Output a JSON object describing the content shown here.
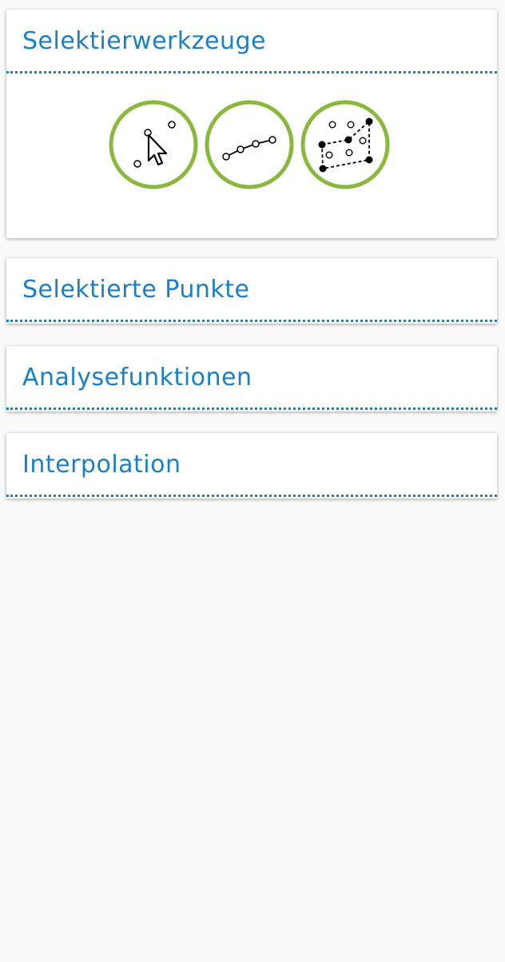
{
  "panels": {
    "selection_tools": {
      "title": "Selektierwerkzeuge"
    },
    "selected_points": {
      "title": "Selektierte Punkte"
    },
    "analysis_functions": {
      "title": "Analysefunktionen"
    },
    "interpolation": {
      "title": "Interpolation"
    }
  },
  "tools": [
    {
      "icon": "pointer-select-icon"
    },
    {
      "icon": "line-select-icon"
    },
    {
      "icon": "polygon-select-icon"
    }
  ],
  "colors": {
    "accent": "#1a7fc6",
    "tool_ring": "#8ab83c",
    "background": "#fafafa",
    "panel": "#ffffff"
  }
}
